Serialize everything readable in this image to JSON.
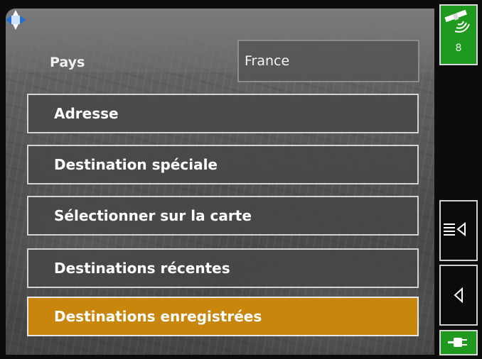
{
  "country": {
    "label": "Pays",
    "value": "France"
  },
  "menu": {
    "items": [
      {
        "label": "Adresse",
        "selected": false
      },
      {
        "label": "Destination spéciale",
        "selected": false
      },
      {
        "label": "Sélectionner sur la carte",
        "selected": false
      },
      {
        "label": "Destinations récentes",
        "selected": false
      },
      {
        "label": "Destinations enregistrées",
        "selected": true
      }
    ]
  },
  "status": {
    "satellites": "8"
  },
  "colors": {
    "selected_accent": "#c8860d",
    "status_green": "#1f9a1f",
    "nav_icon_blue": "#1e6fd6"
  },
  "icons": {
    "nav": "compass-arrows-icon",
    "gps": "satellite-icon",
    "menu": "list-menu-icon",
    "back": "back-triangle-icon",
    "power": "power-plug-icon"
  }
}
